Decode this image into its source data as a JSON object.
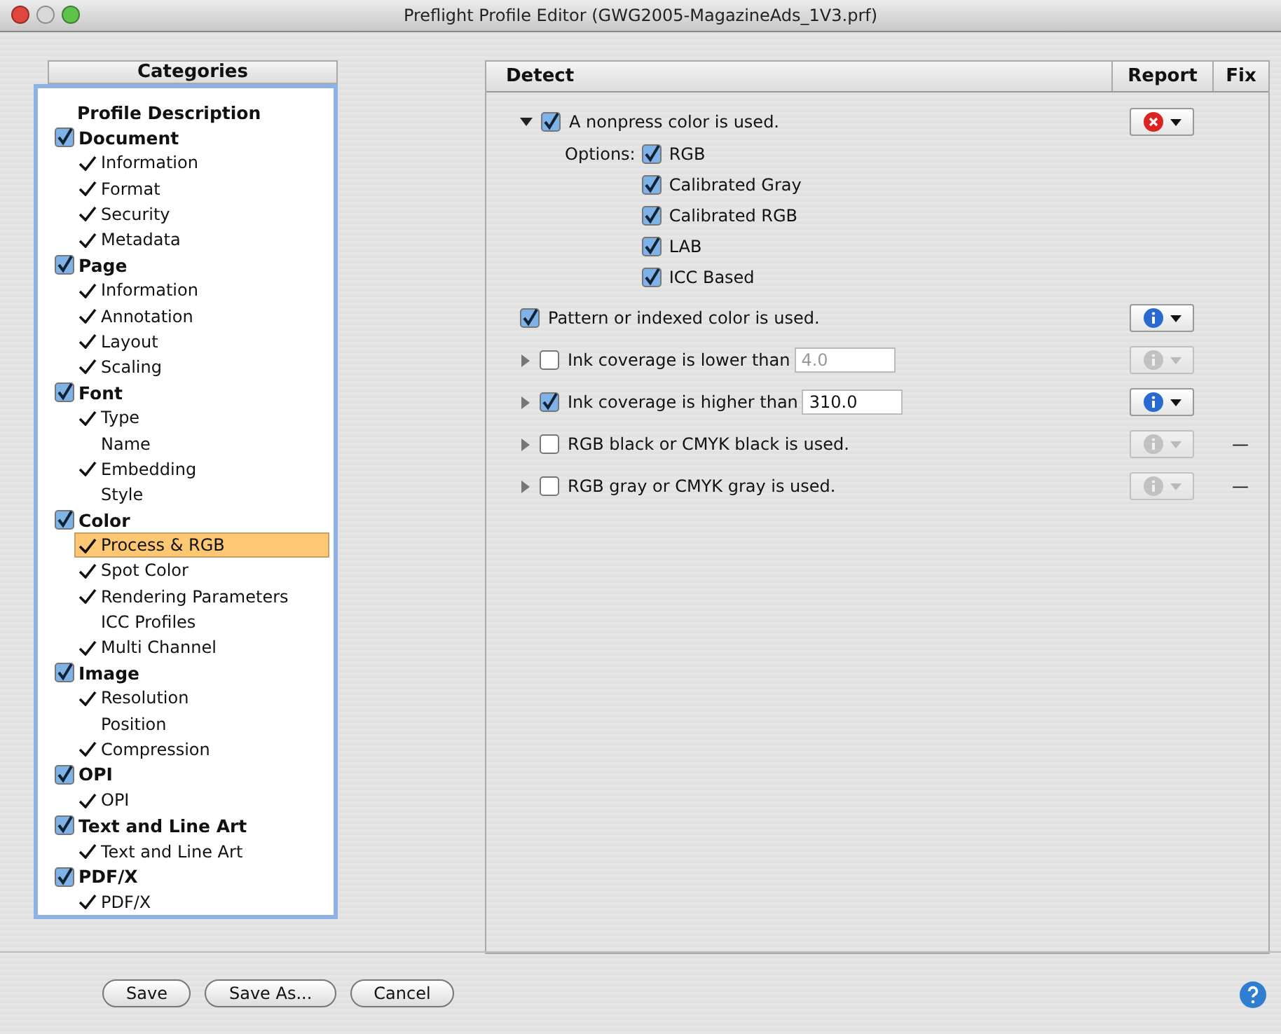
{
  "window": {
    "title": "Preflight Profile Editor (GWG2005-MagazineAds_1V3.prf)"
  },
  "sidebar": {
    "header": "Categories",
    "items": [
      {
        "kind": "plain",
        "label": "Profile Description"
      },
      {
        "kind": "group",
        "label": "Document",
        "checked": true,
        "children": [
          {
            "label": "Information",
            "checked": true,
            "selected": false
          },
          {
            "label": "Format",
            "checked": true,
            "selected": false
          },
          {
            "label": "Security",
            "checked": true,
            "selected": false
          },
          {
            "label": "Metadata",
            "checked": true,
            "selected": false
          }
        ]
      },
      {
        "kind": "group",
        "label": "Page",
        "checked": true,
        "children": [
          {
            "label": "Information",
            "checked": true,
            "selected": false
          },
          {
            "label": "Annotation",
            "checked": true,
            "selected": false
          },
          {
            "label": "Layout",
            "checked": true,
            "selected": false
          },
          {
            "label": "Scaling",
            "checked": true,
            "selected": false
          }
        ]
      },
      {
        "kind": "group",
        "label": "Font",
        "checked": true,
        "children": [
          {
            "label": "Type",
            "checked": true,
            "selected": false
          },
          {
            "label": "Name",
            "checked": false,
            "selected": false
          },
          {
            "label": "Embedding",
            "checked": true,
            "selected": false
          },
          {
            "label": "Style",
            "checked": false,
            "selected": false
          }
        ]
      },
      {
        "kind": "group",
        "label": "Color",
        "checked": true,
        "children": [
          {
            "label": "Process & RGB",
            "checked": true,
            "selected": true
          },
          {
            "label": "Spot Color",
            "checked": true,
            "selected": false
          },
          {
            "label": "Rendering Parameters",
            "checked": true,
            "selected": false
          },
          {
            "label": "ICC Profiles",
            "checked": false,
            "selected": false
          },
          {
            "label": "Multi Channel",
            "checked": true,
            "selected": false
          }
        ]
      },
      {
        "kind": "group",
        "label": "Image",
        "checked": true,
        "children": [
          {
            "label": "Resolution",
            "checked": true,
            "selected": false
          },
          {
            "label": "Position",
            "checked": false,
            "selected": false
          },
          {
            "label": "Compression",
            "checked": true,
            "selected": false
          }
        ]
      },
      {
        "kind": "group",
        "label": "OPI",
        "checked": true,
        "children": [
          {
            "label": "OPI",
            "checked": true,
            "selected": false
          }
        ]
      },
      {
        "kind": "group",
        "label": "Text and Line Art",
        "checked": true,
        "children": [
          {
            "label": "Text and Line Art",
            "checked": true,
            "selected": false
          }
        ]
      },
      {
        "kind": "group",
        "label": "PDF/X",
        "checked": true,
        "children": [
          {
            "label": "PDF/X",
            "checked": true,
            "selected": false
          }
        ]
      }
    ]
  },
  "detect": {
    "columns": [
      "Detect",
      "Report",
      "Fix"
    ],
    "rows": [
      {
        "kind": "options",
        "expanded": true,
        "checked": true,
        "label": "A nonpress color is used.",
        "report": {
          "kind": "error",
          "disabled": false
        },
        "options_label": "Options:",
        "options": [
          {
            "label": "RGB",
            "checked": true
          },
          {
            "label": "Calibrated Gray",
            "checked": true
          },
          {
            "label": "Calibrated RGB",
            "checked": true
          },
          {
            "label": "LAB",
            "checked": true
          },
          {
            "label": "ICC Based",
            "checked": true
          }
        ]
      },
      {
        "kind": "plain",
        "checked": true,
        "label": "Pattern or indexed color is used.",
        "report": {
          "kind": "info",
          "disabled": false
        }
      },
      {
        "kind": "value",
        "expanded": false,
        "checked": false,
        "label": "Ink coverage is lower than",
        "value": "4.0",
        "report": {
          "kind": "info",
          "disabled": true
        }
      },
      {
        "kind": "value",
        "expanded": false,
        "checked": true,
        "label": "Ink coverage is higher than",
        "value": "310.0",
        "report": {
          "kind": "info",
          "disabled": false
        }
      },
      {
        "kind": "plain",
        "expanded": false,
        "checked": false,
        "label": "RGB black or CMYK black is used.",
        "report": {
          "kind": "info",
          "disabled": true
        },
        "fix": "—"
      },
      {
        "kind": "plain",
        "expanded": false,
        "checked": false,
        "label": "RGB gray or CMYK gray is used.",
        "report": {
          "kind": "info",
          "disabled": true
        },
        "fix": "—"
      }
    ]
  },
  "buttons": [
    "Save",
    "Save As...",
    "Cancel"
  ]
}
